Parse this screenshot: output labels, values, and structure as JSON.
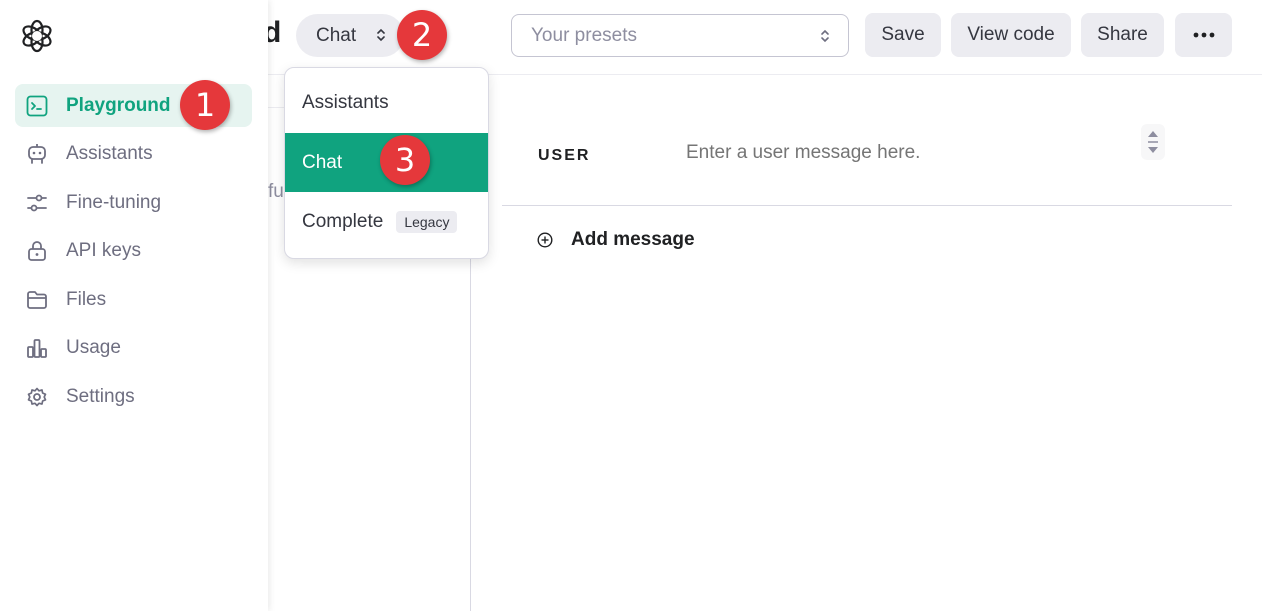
{
  "header": {
    "title_fragment": "d",
    "mode_select": {
      "value": "Chat"
    },
    "presets": {
      "placeholder": "Your presets"
    },
    "buttons": {
      "save": "Save",
      "view_code": "View code",
      "share": "Share"
    }
  },
  "sidebar": {
    "items": [
      {
        "label": "Playground",
        "icon": "terminal-icon",
        "active": true
      },
      {
        "label": "Assistants",
        "icon": "robot-icon"
      },
      {
        "label": "Fine-tuning",
        "icon": "sliders-icon"
      },
      {
        "label": "API keys",
        "icon": "lock-icon"
      },
      {
        "label": "Files",
        "icon": "folder-icon"
      },
      {
        "label": "Usage",
        "icon": "bar-chart-icon"
      },
      {
        "label": "Settings",
        "icon": "gear-icon"
      }
    ]
  },
  "dropdown": {
    "items": [
      {
        "label": "Assistants"
      },
      {
        "label": "Chat",
        "selected": true
      },
      {
        "label": "Complete",
        "badge": "Legacy"
      }
    ]
  },
  "main": {
    "ghost_text": "fu",
    "user_role": "USER",
    "user_placeholder": "Enter a user message here.",
    "add_message": "Add message"
  },
  "markers": [
    "1",
    "2",
    "3"
  ],
  "colors": {
    "accent": "#10a37f",
    "marker": "#e5383b",
    "active_bg": "#e6f4f0"
  }
}
